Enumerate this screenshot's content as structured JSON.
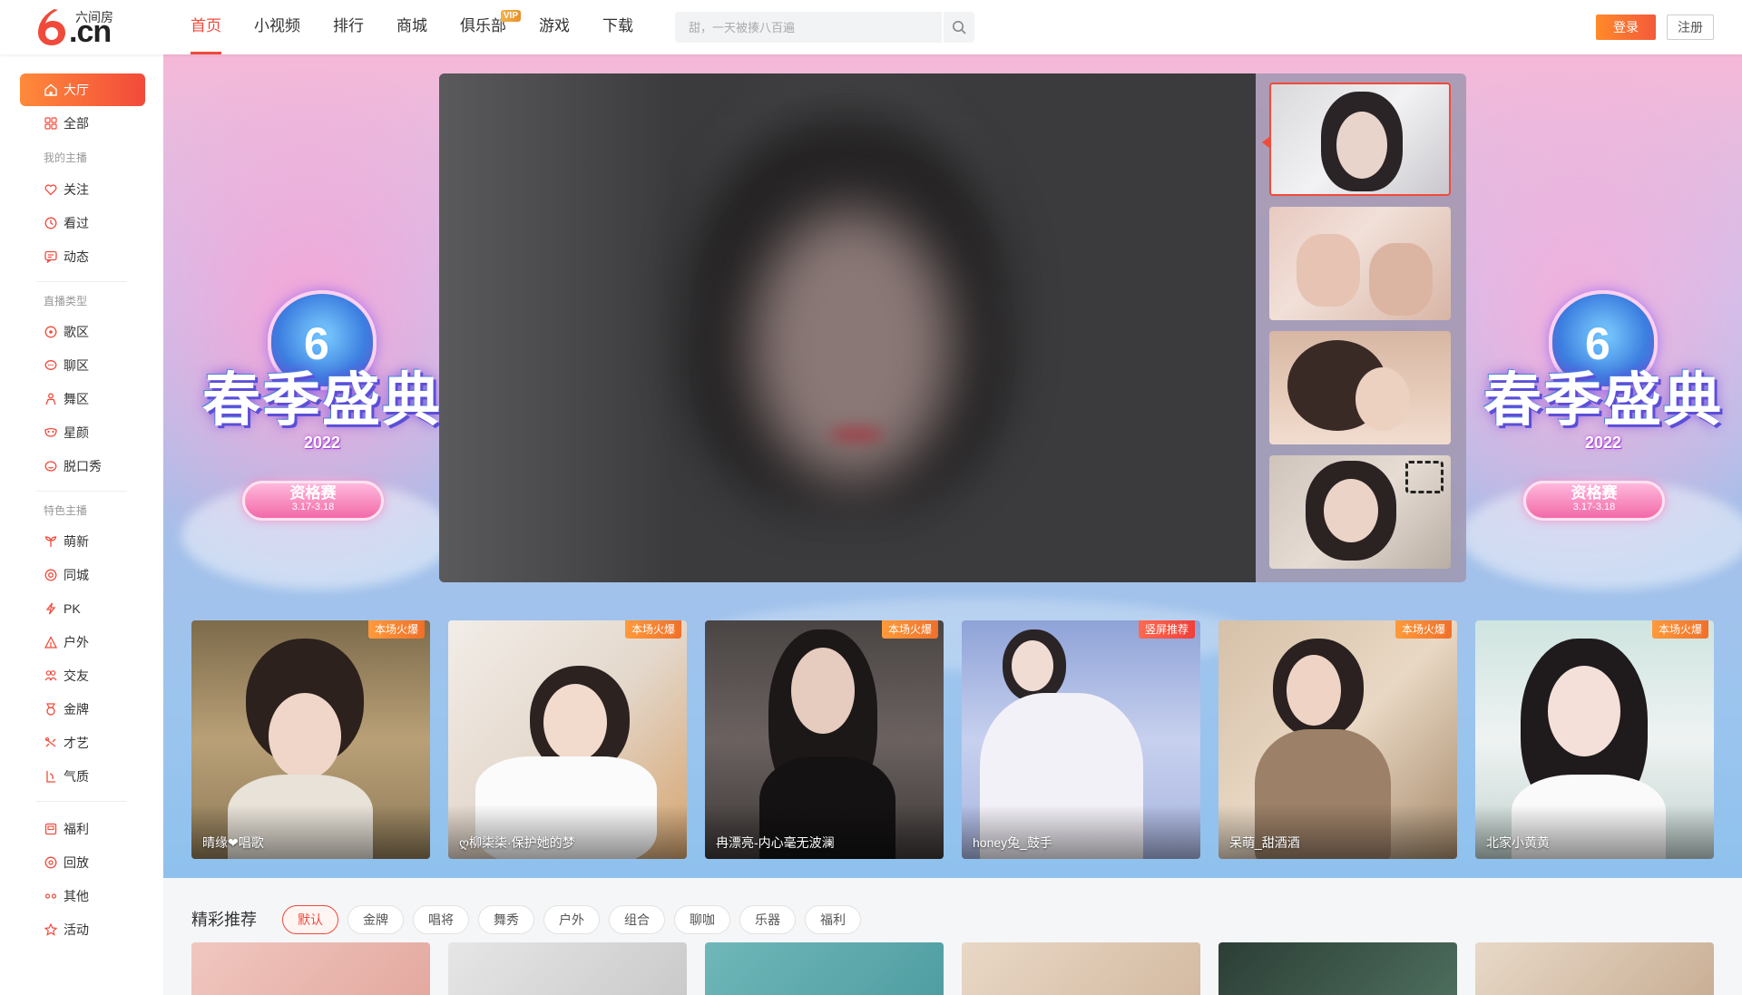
{
  "logo": {
    "brand_cn": "六间房",
    "domain": ".cn"
  },
  "nav": [
    {
      "label": "首页",
      "active": true
    },
    {
      "label": "小视频"
    },
    {
      "label": "排行"
    },
    {
      "label": "商城"
    },
    {
      "label": "俱乐部",
      "badge": "VIP"
    },
    {
      "label": "游戏"
    },
    {
      "label": "下载"
    }
  ],
  "search": {
    "placeholder": "甜，一天被揍八百遍"
  },
  "auth": {
    "login": "登录",
    "register": "注册"
  },
  "sidebar": {
    "top": [
      {
        "label": "大厅",
        "icon": "home-icon",
        "active": true
      },
      {
        "label": "全部",
        "icon": "grid-icon"
      }
    ],
    "group_my": "我的主播",
    "my": [
      {
        "label": "关注",
        "icon": "heart-icon"
      },
      {
        "label": "看过",
        "icon": "clock-icon"
      },
      {
        "label": "动态",
        "icon": "message-icon"
      }
    ],
    "group_type": "直播类型",
    "types": [
      {
        "label": "歌区",
        "icon": "music-icon"
      },
      {
        "label": "聊区",
        "icon": "chat-icon"
      },
      {
        "label": "舞区",
        "icon": "dance-icon"
      },
      {
        "label": "星颜",
        "icon": "mask-icon"
      },
      {
        "label": "脱口秀",
        "icon": "talk-icon"
      }
    ],
    "group_feature": "特色主播",
    "features": [
      {
        "label": "萌新",
        "icon": "sprout-icon"
      },
      {
        "label": "同城",
        "icon": "location-icon"
      },
      {
        "label": "PK",
        "icon": "lightning-icon"
      },
      {
        "label": "户外",
        "icon": "outdoor-icon"
      },
      {
        "label": "交友",
        "icon": "friends-icon"
      },
      {
        "label": "金牌",
        "icon": "medal-icon"
      },
      {
        "label": "才艺",
        "icon": "talent-icon"
      },
      {
        "label": "气质",
        "icon": "style-icon"
      }
    ],
    "others": [
      {
        "label": "福利",
        "icon": "gift-icon"
      },
      {
        "label": "回放",
        "icon": "replay-icon"
      },
      {
        "label": "其他",
        "icon": "more-icon"
      },
      {
        "label": "活动",
        "icon": "star-icon"
      }
    ]
  },
  "banner": {
    "title": "春季盛典",
    "year": "2022",
    "pill": "资格赛",
    "date": "3.17-3.18"
  },
  "hot_cards": [
    {
      "name": "晴缘❤唱歌",
      "tag": "本场火爆",
      "tag_style": "orange"
    },
    {
      "name": "ღ柳柒柒·保护她的梦",
      "tag": "本场火爆",
      "tag_style": "orange"
    },
    {
      "name": "冉漂亮-内心毫无波澜",
      "tag": "本场火爆",
      "tag_style": "orange"
    },
    {
      "name": "honey兔_鼓手",
      "tag": "竖屏推荐",
      "tag_style": "red"
    },
    {
      "name": "呆萌_甜酒酒",
      "tag": "本场火爆",
      "tag_style": "orange"
    },
    {
      "name": "北家小黄黄",
      "tag": "本场火爆",
      "tag_style": "orange"
    }
  ],
  "recommend": {
    "title": "精彩推荐",
    "tabs": [
      {
        "label": "默认",
        "active": true
      },
      {
        "label": "金牌"
      },
      {
        "label": "唱将"
      },
      {
        "label": "舞秀"
      },
      {
        "label": "户外"
      },
      {
        "label": "组合"
      },
      {
        "label": "聊咖"
      },
      {
        "label": "乐器"
      },
      {
        "label": "福利"
      }
    ]
  },
  "colors": {
    "accent": "#f24a3a",
    "accent_orange": "#ff8a3a",
    "banner_top": "#f6b8d8",
    "banner_bottom": "#8fc1ee"
  }
}
